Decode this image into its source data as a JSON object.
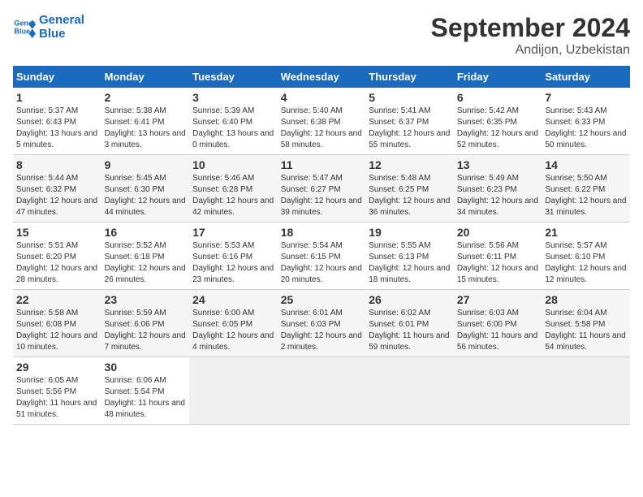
{
  "header": {
    "logo_line1": "General",
    "logo_line2": "Blue",
    "month": "September 2024",
    "location": "Andijon, Uzbekistan"
  },
  "days_of_week": [
    "Sunday",
    "Monday",
    "Tuesday",
    "Wednesday",
    "Thursday",
    "Friday",
    "Saturday"
  ],
  "weeks": [
    [
      {
        "num": "1",
        "sunrise": "Sunrise: 5:37 AM",
        "sunset": "Sunset: 6:43 PM",
        "daylight": "Daylight: 13 hours and 5 minutes."
      },
      {
        "num": "2",
        "sunrise": "Sunrise: 5:38 AM",
        "sunset": "Sunset: 6:41 PM",
        "daylight": "Daylight: 13 hours and 3 minutes."
      },
      {
        "num": "3",
        "sunrise": "Sunrise: 5:39 AM",
        "sunset": "Sunset: 6:40 PM",
        "daylight": "Daylight: 13 hours and 0 minutes."
      },
      {
        "num": "4",
        "sunrise": "Sunrise: 5:40 AM",
        "sunset": "Sunset: 6:38 PM",
        "daylight": "Daylight: 12 hours and 58 minutes."
      },
      {
        "num": "5",
        "sunrise": "Sunrise: 5:41 AM",
        "sunset": "Sunset: 6:37 PM",
        "daylight": "Daylight: 12 hours and 55 minutes."
      },
      {
        "num": "6",
        "sunrise": "Sunrise: 5:42 AM",
        "sunset": "Sunset: 6:35 PM",
        "daylight": "Daylight: 12 hours and 52 minutes."
      },
      {
        "num": "7",
        "sunrise": "Sunrise: 5:43 AM",
        "sunset": "Sunset: 6:33 PM",
        "daylight": "Daylight: 12 hours and 50 minutes."
      }
    ],
    [
      {
        "num": "8",
        "sunrise": "Sunrise: 5:44 AM",
        "sunset": "Sunset: 6:32 PM",
        "daylight": "Daylight: 12 hours and 47 minutes."
      },
      {
        "num": "9",
        "sunrise": "Sunrise: 5:45 AM",
        "sunset": "Sunset: 6:30 PM",
        "daylight": "Daylight: 12 hours and 44 minutes."
      },
      {
        "num": "10",
        "sunrise": "Sunrise: 5:46 AM",
        "sunset": "Sunset: 6:28 PM",
        "daylight": "Daylight: 12 hours and 42 minutes."
      },
      {
        "num": "11",
        "sunrise": "Sunrise: 5:47 AM",
        "sunset": "Sunset: 6:27 PM",
        "daylight": "Daylight: 12 hours and 39 minutes."
      },
      {
        "num": "12",
        "sunrise": "Sunrise: 5:48 AM",
        "sunset": "Sunset: 6:25 PM",
        "daylight": "Daylight: 12 hours and 36 minutes."
      },
      {
        "num": "13",
        "sunrise": "Sunrise: 5:49 AM",
        "sunset": "Sunset: 6:23 PM",
        "daylight": "Daylight: 12 hours and 34 minutes."
      },
      {
        "num": "14",
        "sunrise": "Sunrise: 5:50 AM",
        "sunset": "Sunset: 6:22 PM",
        "daylight": "Daylight: 12 hours and 31 minutes."
      }
    ],
    [
      {
        "num": "15",
        "sunrise": "Sunrise: 5:51 AM",
        "sunset": "Sunset: 6:20 PM",
        "daylight": "Daylight: 12 hours and 28 minutes."
      },
      {
        "num": "16",
        "sunrise": "Sunrise: 5:52 AM",
        "sunset": "Sunset: 6:18 PM",
        "daylight": "Daylight: 12 hours and 26 minutes."
      },
      {
        "num": "17",
        "sunrise": "Sunrise: 5:53 AM",
        "sunset": "Sunset: 6:16 PM",
        "daylight": "Daylight: 12 hours and 23 minutes."
      },
      {
        "num": "18",
        "sunrise": "Sunrise: 5:54 AM",
        "sunset": "Sunset: 6:15 PM",
        "daylight": "Daylight: 12 hours and 20 minutes."
      },
      {
        "num": "19",
        "sunrise": "Sunrise: 5:55 AM",
        "sunset": "Sunset: 6:13 PM",
        "daylight": "Daylight: 12 hours and 18 minutes."
      },
      {
        "num": "20",
        "sunrise": "Sunrise: 5:56 AM",
        "sunset": "Sunset: 6:11 PM",
        "daylight": "Daylight: 12 hours and 15 minutes."
      },
      {
        "num": "21",
        "sunrise": "Sunrise: 5:57 AM",
        "sunset": "Sunset: 6:10 PM",
        "daylight": "Daylight: 12 hours and 12 minutes."
      }
    ],
    [
      {
        "num": "22",
        "sunrise": "Sunrise: 5:58 AM",
        "sunset": "Sunset: 6:08 PM",
        "daylight": "Daylight: 12 hours and 10 minutes."
      },
      {
        "num": "23",
        "sunrise": "Sunrise: 5:59 AM",
        "sunset": "Sunset: 6:06 PM",
        "daylight": "Daylight: 12 hours and 7 minutes."
      },
      {
        "num": "24",
        "sunrise": "Sunrise: 6:00 AM",
        "sunset": "Sunset: 6:05 PM",
        "daylight": "Daylight: 12 hours and 4 minutes."
      },
      {
        "num": "25",
        "sunrise": "Sunrise: 6:01 AM",
        "sunset": "Sunset: 6:03 PM",
        "daylight": "Daylight: 12 hours and 2 minutes."
      },
      {
        "num": "26",
        "sunrise": "Sunrise: 6:02 AM",
        "sunset": "Sunset: 6:01 PM",
        "daylight": "Daylight: 11 hours and 59 minutes."
      },
      {
        "num": "27",
        "sunrise": "Sunrise: 6:03 AM",
        "sunset": "Sunset: 6:00 PM",
        "daylight": "Daylight: 11 hours and 56 minutes."
      },
      {
        "num": "28",
        "sunrise": "Sunrise: 6:04 AM",
        "sunset": "Sunset: 5:58 PM",
        "daylight": "Daylight: 11 hours and 54 minutes."
      }
    ],
    [
      {
        "num": "29",
        "sunrise": "Sunrise: 6:05 AM",
        "sunset": "Sunset: 5:56 PM",
        "daylight": "Daylight: 11 hours and 51 minutes."
      },
      {
        "num": "30",
        "sunrise": "Sunrise: 6:06 AM",
        "sunset": "Sunset: 5:54 PM",
        "daylight": "Daylight: 11 hours and 48 minutes."
      },
      null,
      null,
      null,
      null,
      null
    ]
  ]
}
